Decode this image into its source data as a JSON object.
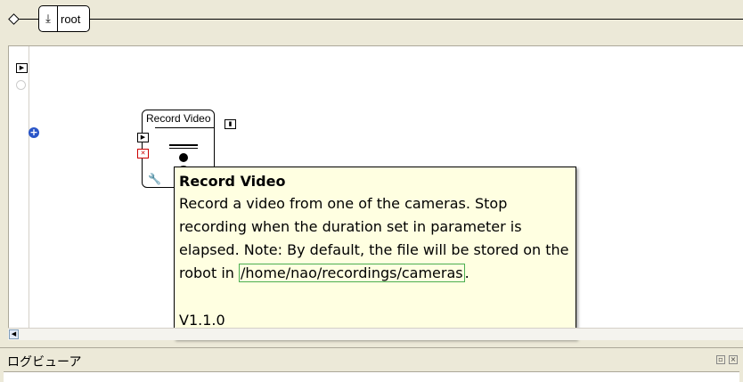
{
  "breadcrumb": {
    "root_label": "root",
    "root_icon": "download-arrow-icon"
  },
  "box": {
    "title": "Record Video",
    "icons": [
      "start-input-icon",
      "stop-input-icon",
      "output-icon",
      "camera-art-icon",
      "wrench-icon"
    ]
  },
  "tooltip": {
    "title": "Record Video",
    "body_before": "Record a video from one of the cameras. Stop recording when the duration set in parameter is elapsed. Note: By default, the file will be stored on the robot in ",
    "path": "/home/nao/recordings/cameras",
    "body_after": ".",
    "version": "V1.1.0",
    "background": "#ffffe1"
  },
  "log_panel": {
    "title": "ログビューア"
  }
}
